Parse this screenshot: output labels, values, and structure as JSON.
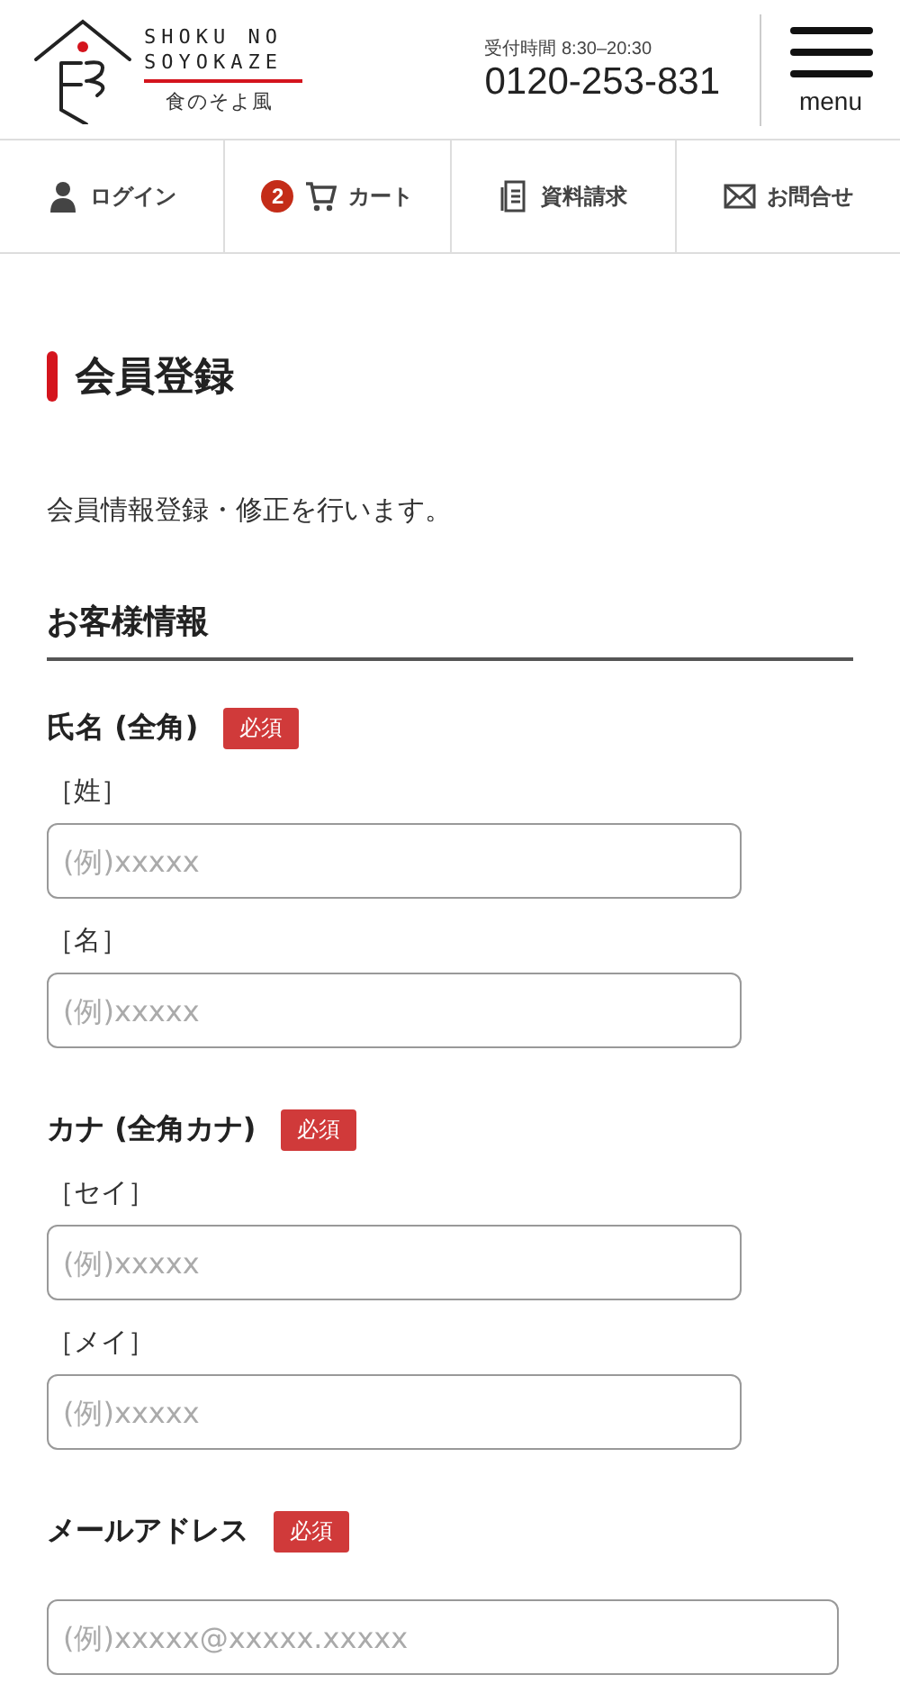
{
  "header": {
    "logo_lines": [
      "SHOKU NO",
      "SOYOKAZE"
    ],
    "logo_japanese": "食のそよ風",
    "hours": "受付時間 8:30–20:30",
    "phone": "0120-253-831",
    "menu_label": "menu"
  },
  "nav": [
    {
      "kind": "login",
      "label": "ログイン"
    },
    {
      "kind": "cart",
      "label": "カート",
      "badge": "2"
    },
    {
      "kind": "document",
      "label": "資料請求"
    },
    {
      "kind": "mail",
      "label": "お問合せ"
    }
  ],
  "page_title": "会員登録",
  "description": "会員情報登録・修正を行います。",
  "section_heading": "お客様情報",
  "groups": [
    {
      "label": "氏名 (全角)",
      "required": true,
      "required_label": "必須",
      "wide": false,
      "fields": [
        {
          "sublabel": "［姓］",
          "placeholder": "(例)xxxxx"
        },
        {
          "sublabel": "［名］",
          "placeholder": "(例)xxxxx"
        }
      ]
    },
    {
      "label": "カナ (全角カナ)",
      "required": true,
      "required_label": "必須",
      "wide": false,
      "fields": [
        {
          "sublabel": "［セイ］",
          "placeholder": "(例)xxxxx"
        },
        {
          "sublabel": "［メイ］",
          "placeholder": "(例)xxxxx"
        }
      ]
    },
    {
      "label": "メールアドレス",
      "required": true,
      "required_label": "必須",
      "wide": true,
      "fields": [
        {
          "placeholder": "(例)xxxxx@xxxxx.xxxxx"
        }
      ]
    }
  ]
}
